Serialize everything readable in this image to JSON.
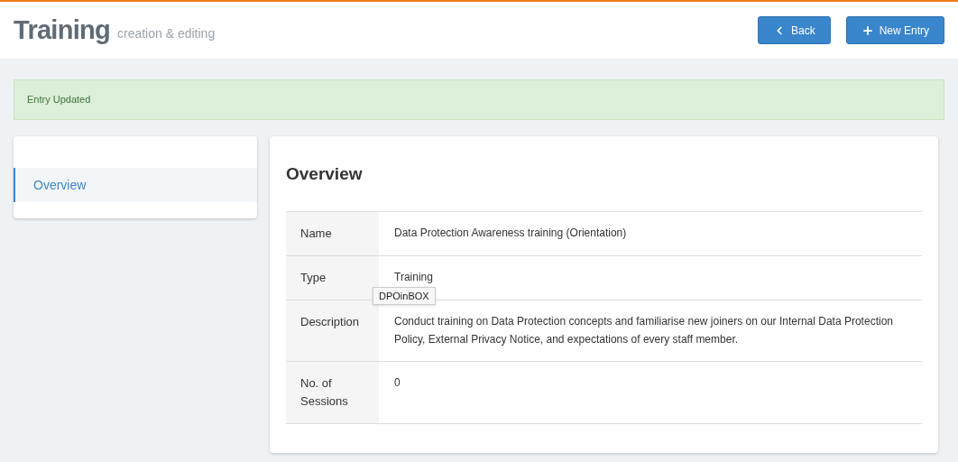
{
  "header": {
    "title": "Training",
    "subtitle": "creation & editing",
    "buttons": [
      {
        "kind": "back",
        "label": "Back"
      },
      {
        "kind": "new",
        "label": "New Entry"
      }
    ]
  },
  "alert": {
    "text": "Entry Updated"
  },
  "sidebar": {
    "items": [
      {
        "label": "Overview",
        "selected": true
      }
    ]
  },
  "panel": {
    "title": "Overview",
    "rows": [
      {
        "label": "Name",
        "value": "Data Protection Awareness training (Orientation)"
      },
      {
        "label": "Type",
        "value": "Training",
        "tooltip": "DPOinBOX"
      },
      {
        "label": "Description",
        "value": "Conduct training on Data Protection concepts and familiarise new joiners on our Internal Data Protection Policy, External Privacy Notice, and expectations of every staff member."
      },
      {
        "label": "No. of Sessions",
        "value": "0"
      }
    ]
  }
}
